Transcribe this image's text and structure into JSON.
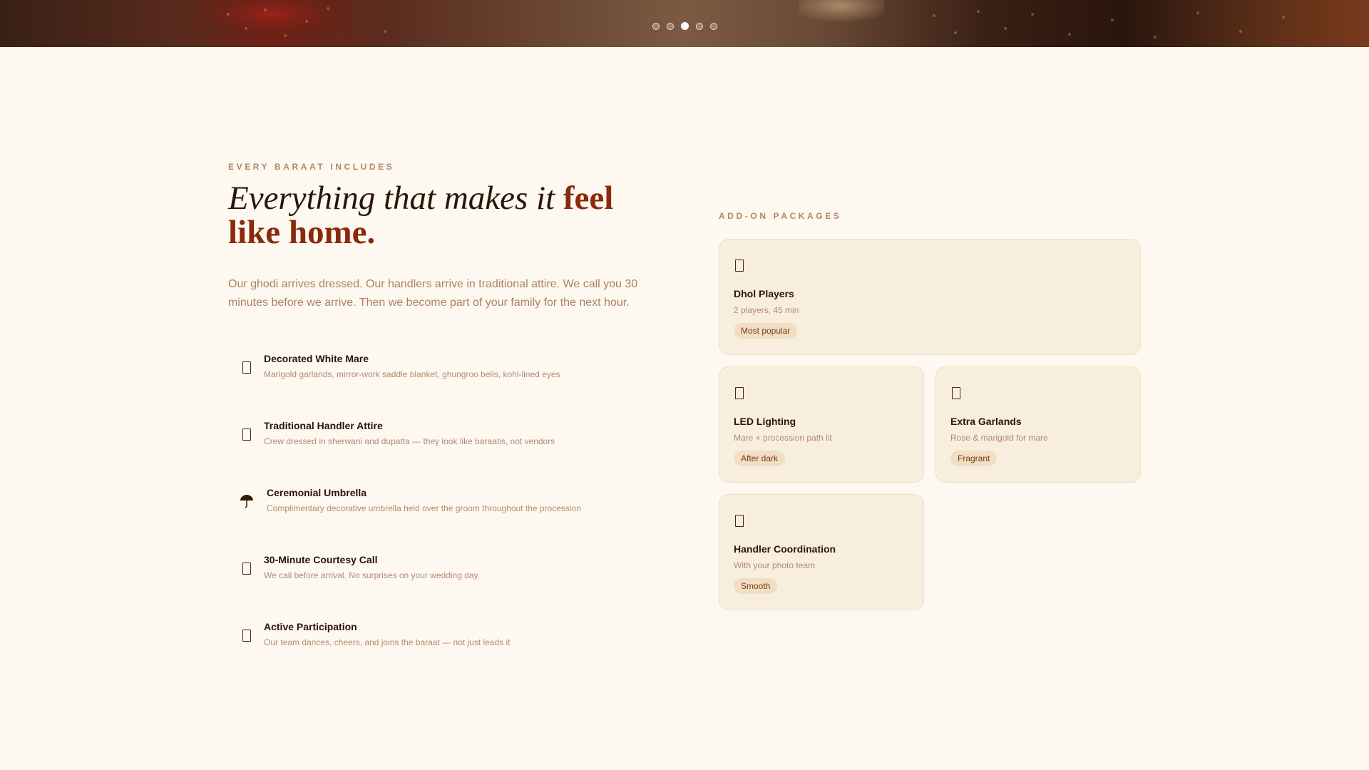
{
  "hero": {
    "carousel_dots": 5,
    "active_dot_index": 2
  },
  "includes": {
    "eyebrow": "EVERY BARAAT INCLUDES",
    "headline_light": "Everything that makes it ",
    "headline_accent": "feel like home.",
    "intro": "Our ghodi arrives dressed. Our handlers arrive in traditional attire. We call you 30 minutes before we arrive. Then we become part of your family for the next hour.",
    "items": [
      {
        "icon": "square-icon",
        "title": "Decorated White Mare",
        "description": "Marigold garlands, mirror-work saddle blanket, ghungroo bells, kohl-lined eyes"
      },
      {
        "icon": "square-icon",
        "title": "Traditional Handler Attire",
        "description": "Crew dressed in sherwani and dupatta — they look like baraatis, not vendors"
      },
      {
        "icon": "umbrella-icon",
        "title": "Ceremonial Umbrella",
        "description": "Complimentary decorative umbrella held over the groom throughout the procession"
      },
      {
        "icon": "square-icon",
        "title": "30-Minute Courtesy Call",
        "description": "We call before arrival. No surprises on your wedding day."
      },
      {
        "icon": "square-icon",
        "title": "Active Participation",
        "description": "Our team dances, cheers, and joins the baraat — not just leads it"
      }
    ]
  },
  "addons": {
    "eyebrow": "ADD-ON PACKAGES",
    "packages": [
      {
        "icon": "square-icon",
        "title": "Dhol Players",
        "subtitle": "2 players, 45 min",
        "badge": "Most popular"
      },
      {
        "icon": "square-icon",
        "title": "LED Lighting",
        "subtitle": "Mare + procession path lit",
        "badge": "After dark"
      },
      {
        "icon": "square-icon",
        "title": "Extra Garlands",
        "subtitle": "Rose & marigold for mare",
        "badge": "Fragrant"
      },
      {
        "icon": "square-icon",
        "title": "Handler Coordination",
        "subtitle": "With your photo team",
        "badge": "Smooth"
      }
    ]
  },
  "colors": {
    "background": "#fdf8f0",
    "accent": "#8a2a0c",
    "card_bg": "#f8eedd",
    "badge_bg": "#f1dfc3",
    "muted_text": "#b07f63"
  }
}
